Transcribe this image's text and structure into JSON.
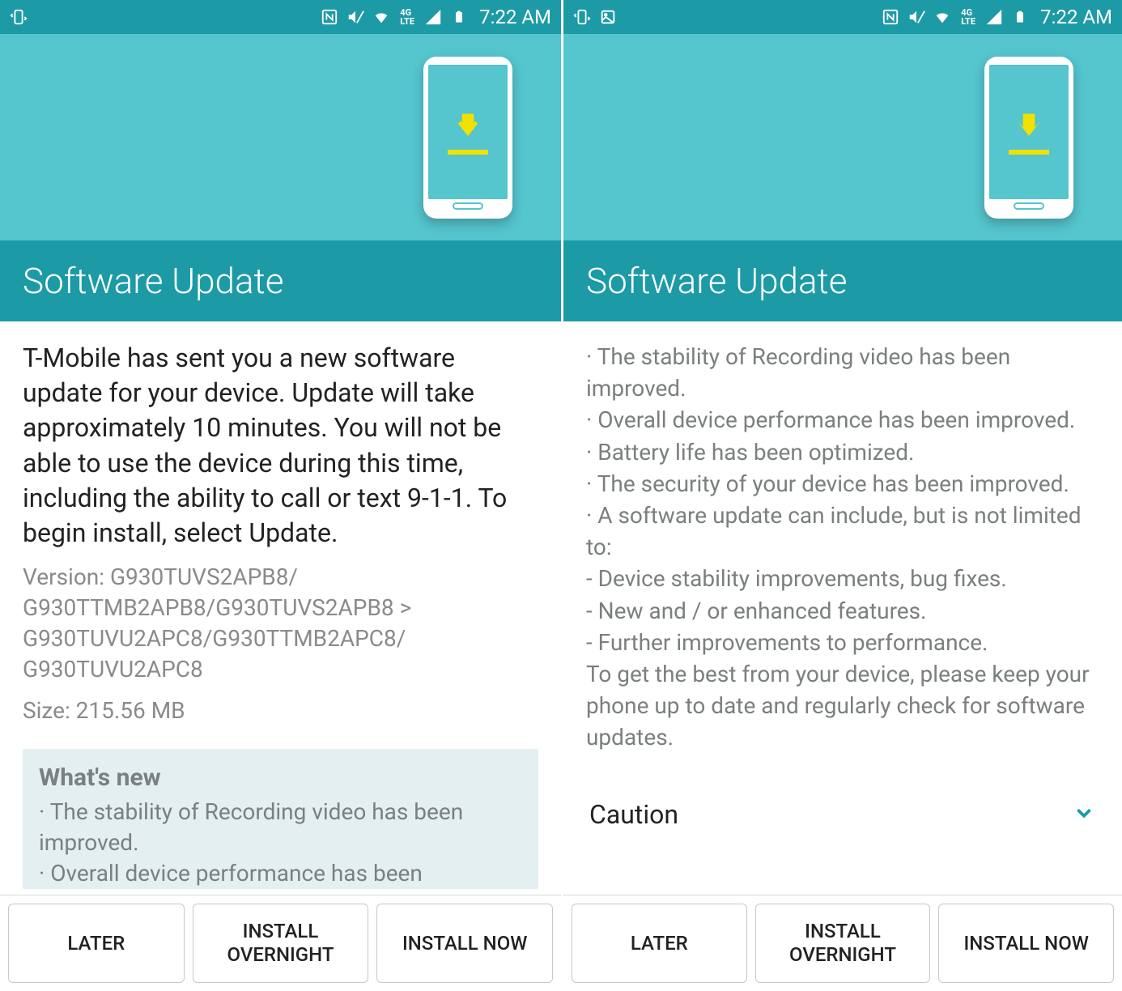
{
  "left": {
    "statusbar": {
      "time": "7:22 AM"
    },
    "title": "Software Update",
    "description": "T-Mobile has sent you a new software update for your device. Update will take approximately 10 minutes. You will not be able to use the device during this time, including the ability to call or text 9-1-1. To begin install, select Update.",
    "version": "Version: G930TUVS2APB8/\nG930TTMB2APB8/G930TUVS2APB8 >\nG930TUVU2APC8/G930TTMB2APC8/\nG930TUVU2APC8",
    "size": "Size: 215.56 MB",
    "whatsnew_title": "What's new",
    "whatsnew_text": "· The stability of Recording video has been improved.\n· Overall device performance has been",
    "buttons": {
      "later": "LATER",
      "overnight": "INSTALL\nOVERNIGHT",
      "now": "INSTALL NOW"
    }
  },
  "right": {
    "statusbar": {
      "time": "7:22 AM"
    },
    "title": "Software Update",
    "notes": "· The stability of Recording video has been improved.\n· Overall device performance has been improved.\n· Battery life has been optimized.\n· The security of your device has been improved.\n· A software update can include, but is not limited to:\n - Device stability improvements, bug fixes.\n - New and / or enhanced features.\n - Further improvements to performance.\nTo get the best from your device, please keep your phone up to date and regularly check for software updates.",
    "caution": "Caution",
    "buttons": {
      "later": "LATER",
      "overnight": "INSTALL\nOVERNIGHT",
      "now": "INSTALL NOW"
    }
  }
}
